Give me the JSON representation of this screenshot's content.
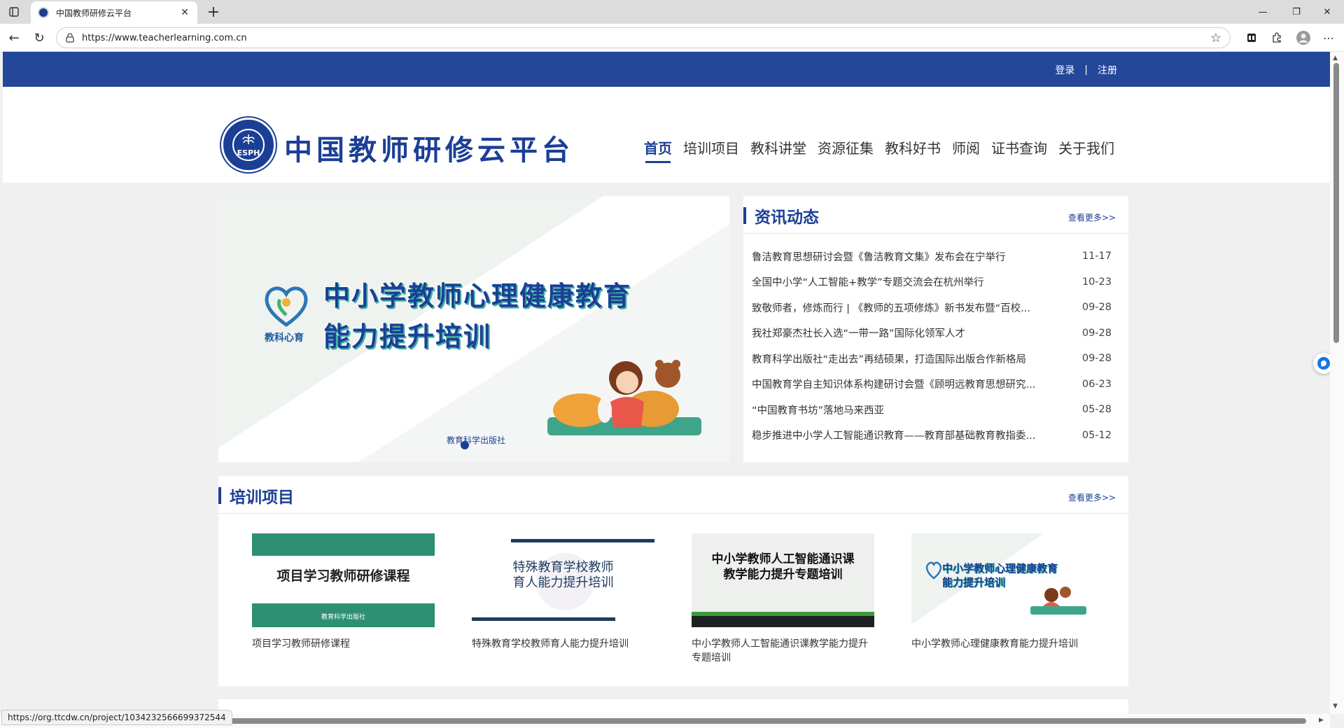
{
  "browser": {
    "tab_title": "中国教师研修云平台",
    "url": "https://www.teacherlearning.com.cn",
    "status_url": "https://org.ttcdw.cn/project/1034232566699372544"
  },
  "topbar": {
    "login": "登录",
    "separator": "|",
    "register": "注册"
  },
  "header": {
    "logo_seal_text": "ESPH",
    "site_title": "中国教师研修云平台",
    "nav": [
      "首页",
      "培训项目",
      "教科讲堂",
      "资源征集",
      "教科好书",
      "师阅",
      "证书查询",
      "关于我们"
    ],
    "active_nav": "首页"
  },
  "banner": {
    "brand": "教科心育",
    "title_line1": "中小学教师心理健康教育",
    "title_line2": "能力提升培训",
    "publisher": "教育科学出版社"
  },
  "news": {
    "title": "资讯动态",
    "more": "查看更多>>",
    "items": [
      {
        "title": "鲁洁教育思想研讨会暨《鲁洁教育文集》发布会在宁举行",
        "date": "11-17"
      },
      {
        "title": "全国中小学“人工智能+教学”专题交流会在杭州举行",
        "date": "10-23"
      },
      {
        "title": "致敬师者，修炼而行 | 《教师的五项修炼》新书发布暨“百校...",
        "date": "09-28"
      },
      {
        "title": "我社郑豪杰社长入选“一带一路”国际化领军人才",
        "date": "09-28"
      },
      {
        "title": "教育科学出版社“走出去”再结硕果，打造国际出版合作新格局",
        "date": "09-28"
      },
      {
        "title": "中国教育学自主知识体系构建研讨会暨《顾明远教育思想研究...",
        "date": "06-23"
      },
      {
        "title": "“中国教育书坊”落地马来西亚",
        "date": "05-28"
      },
      {
        "title": "稳步推进中小学人工智能通识教育——教育部基础教育教指委...",
        "date": "05-12"
      }
    ]
  },
  "training": {
    "title": "培训项目",
    "more": "查看更多>>",
    "cards": [
      {
        "thumb_title": "项目学习教师研修课程",
        "thumb_pub": "教育科学出版社",
        "caption": "项目学习教师研修课程"
      },
      {
        "thumb_line1": "特殊教育学校教师",
        "thumb_line2": "育人能力提升培训",
        "caption": "特殊教育学校教师育人能力提升培训"
      },
      {
        "thumb_line1": "中小学教师人工智能通识课",
        "thumb_line2": "教学能力提升专题培训",
        "caption": "中小学教师人工智能通识课教学能力提升专题培训"
      },
      {
        "thumb_line1": "中小学教师心理健康教育",
        "thumb_line2": "能力提升培训",
        "caption": "中小学教师心理健康教育能力提升培训"
      }
    ]
  },
  "colors": {
    "brand_blue": "#24479a",
    "accent_teal": "#3fb3a5",
    "card_green": "#2e8f72"
  }
}
